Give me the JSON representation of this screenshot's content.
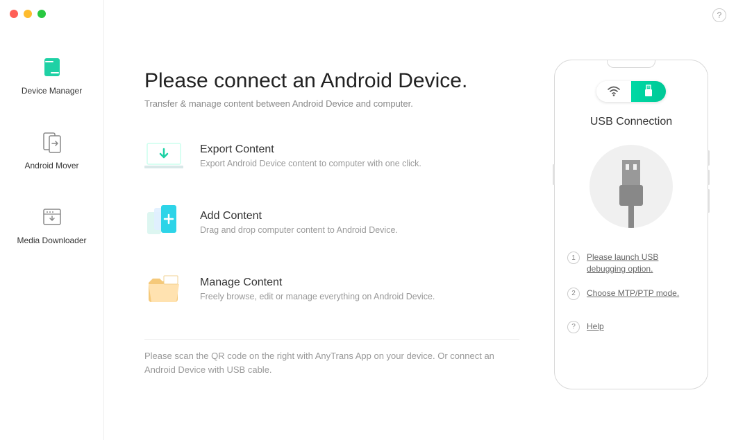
{
  "sidebar": {
    "items": [
      {
        "label": "Device Manager"
      },
      {
        "label": "Android Mover"
      },
      {
        "label": "Media Downloader"
      }
    ]
  },
  "main": {
    "title": "Please connect an Android Device.",
    "subtitle": "Transfer & manage content between Android Device and computer.",
    "features": [
      {
        "title": "Export Content",
        "desc": "Export Android Device content to computer with one click."
      },
      {
        "title": "Add Content",
        "desc": "Drag and drop computer content to Android Device."
      },
      {
        "title": "Manage Content",
        "desc": "Freely browse, edit or manage everything on Android Device."
      }
    ],
    "footer": "Please scan the QR code on the right with AnyTrans App on your device. Or connect an Android Device with USB cable."
  },
  "phone": {
    "connection_title": "USB Connection",
    "steps": [
      {
        "num": "1",
        "text": "Please launch USB debugging option."
      },
      {
        "num": "2",
        "text": "Choose MTP/PTP mode."
      }
    ],
    "help": {
      "mark": "?",
      "text": "Help"
    }
  },
  "help_button": "?"
}
